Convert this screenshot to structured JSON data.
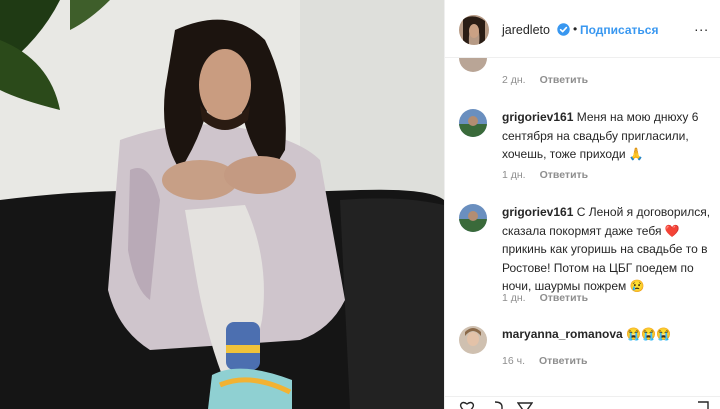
{
  "post": {
    "photo_alt": "photo"
  },
  "header": {
    "username": "jaredleto",
    "separator": "•",
    "follow_label": "Подписаться",
    "more_label": "..."
  },
  "comments": [
    {
      "username": "",
      "text": "",
      "ago": "2 дн.",
      "reply": "Ответить"
    },
    {
      "username": "grigoriev161",
      "text": "Меня на мою днюху 6 сентября на свадьбу пригласили, хочешь, тоже приходи 🙏",
      "ago": "1 дн.",
      "reply": "Ответить"
    },
    {
      "username": "grigoriev161",
      "text": "С Леной я договорился, сказала покормят даже тебя ❤️ прикинь как угоришь на свадьбе то в Ростове! Потом на ЦБГ поедем по ночи, шаурмы пожрем 😢",
      "ago": "1 дн.",
      "reply": "Ответить"
    },
    {
      "username": "maryanna_romanova",
      "text": "😭😭😭",
      "ago": "16 ч.",
      "reply": "Ответить"
    }
  ],
  "colors": {
    "accent": "#3897f0",
    "muted": "#8e8e8e"
  }
}
